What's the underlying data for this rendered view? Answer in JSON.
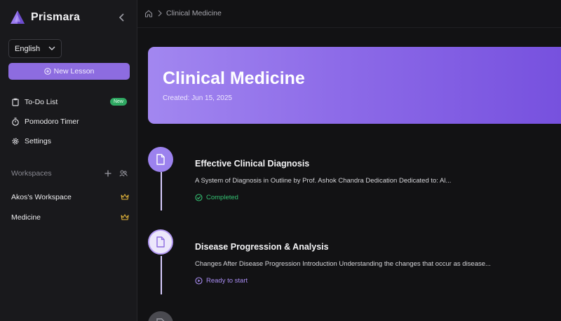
{
  "app": {
    "name": "Prismara"
  },
  "sidebar": {
    "language": "English",
    "new_lesson_label": "New Lesson",
    "nav": [
      {
        "label": "To-Do List",
        "icon": "clipboard-icon",
        "badge": "New"
      },
      {
        "label": "Pomodoro Timer",
        "icon": "stopwatch-icon"
      },
      {
        "label": "Settings",
        "icon": "gear-icon"
      }
    ],
    "workspaces_label": "Workspaces",
    "workspaces": [
      {
        "label": "Akos's Workspace",
        "icon": "crown-icon"
      },
      {
        "label": "Medicine",
        "icon": "crown-icon"
      }
    ]
  },
  "breadcrumb": {
    "current": "Clinical Medicine"
  },
  "course": {
    "title": "Clinical Medicine",
    "created": "Created: Jun 15, 2025"
  },
  "lessons": [
    {
      "title": "Effective Clinical Diagnosis",
      "description": "A System of Diagnosis in Outline by Prof. Ashok Chandra Dedication Dedicated to: Al...",
      "status": "Completed"
    },
    {
      "title": "Disease Progression & Analysis",
      "description": "Changes After Disease Progression Introduction Understanding the changes that occur as disease...",
      "status": "Ready to start"
    }
  ],
  "colors": {
    "accent": "#8d6ce0",
    "completed": "#34c072",
    "ready": "#a88cf2",
    "crown": "#e2b43a"
  }
}
